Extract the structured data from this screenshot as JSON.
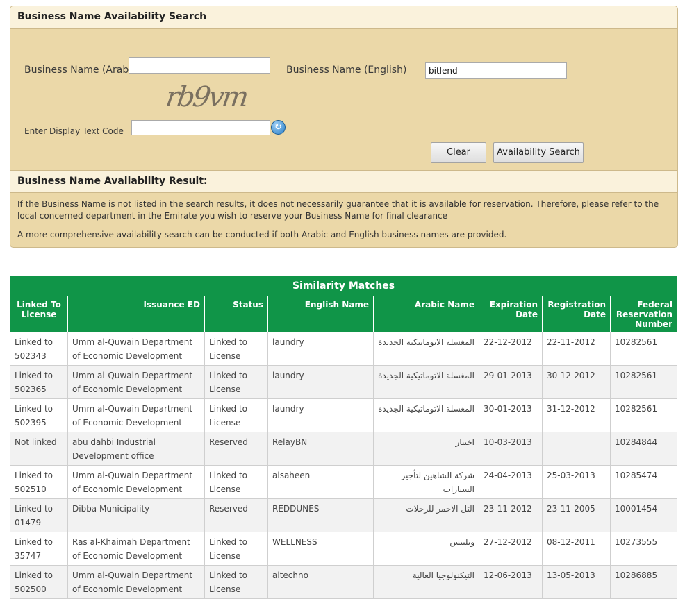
{
  "search": {
    "title": "Business Name Availability Search",
    "arabic_label": "Business Name (Arabic)",
    "arabic_value": "",
    "english_label": "Business Name (English)",
    "english_value": "bitlend",
    "captcha_text": "rb9vm",
    "code_label": "Enter Display Text Code",
    "code_value": "",
    "clear_label": "Clear",
    "search_label": "Availability Search"
  },
  "result": {
    "title": "Business Name Availability Result:",
    "note1": "If the Business Name is not listed in the search results, it does not necessarily guarantee that it is available for reservation. Therefore, please refer to the local concerned department in the Emirate you wish to reserve your Business Name for final clearance",
    "note2": "A more comprehensive availability search can be conducted if both Arabic and English business names are provided."
  },
  "table": {
    "caption": "Similarity Matches",
    "headers": [
      "Linked To License",
      "Issuance ED",
      "Status",
      "English Name",
      "Arabic Name",
      "Expiration Date",
      "Registration Date",
      "Federal Reservation Number"
    ],
    "rows": [
      [
        "Linked to 502343",
        "Umm al-Quwain Department of Economic Development",
        "Linked to License",
        "laundry",
        "المغسلة الاتوماتيكية الجديدة",
        "22-12-2012",
        "22-11-2012",
        "10282561"
      ],
      [
        "Linked to 502365",
        "Umm al-Quwain Department of Economic Development",
        "Linked to License",
        "laundry",
        "المغسلة الاتوماتيكية الجديدة",
        "29-01-2013",
        "30-12-2012",
        "10282561"
      ],
      [
        "Linked to 502395",
        "Umm al-Quwain Department of Economic Development",
        "Linked to License",
        "laundry",
        "المغسلة الاتوماتيكية الجديدة",
        "30-01-2013",
        "31-12-2012",
        "10282561"
      ],
      [
        "Not linked",
        "abu dahbi Industrial Development office",
        "Reserved",
        "RelayBN",
        "اختبار",
        "10-03-2013",
        "",
        "10284844"
      ],
      [
        "Linked to 502510",
        "Umm al-Quwain Department of Economic Development",
        "Linked to License",
        "alsaheen",
        "شركة الشاهين لتأجير السيارات",
        "24-04-2013",
        "25-03-2013",
        "10285474"
      ],
      [
        "Linked to 01479",
        "Dibba Municipality",
        "Reserved",
        "REDDUNES",
        "التل الاحمر للرحلات",
        "23-11-2012",
        "23-11-2005",
        "10001454"
      ],
      [
        "Linked to 35747",
        "Ras al-Khaimah Department of Economic Development",
        "Linked to License",
        "WELLNESS",
        "ويلنيس",
        "27-12-2012",
        "08-12-2011",
        "10273555"
      ],
      [
        "Linked to 502500",
        "Umm al-Quwain Department of Economic Development",
        "Linked to License",
        "altechno",
        "التيكنولوجيا العالية",
        "12-06-2013",
        "13-05-2013",
        "10286885"
      ]
    ]
  }
}
